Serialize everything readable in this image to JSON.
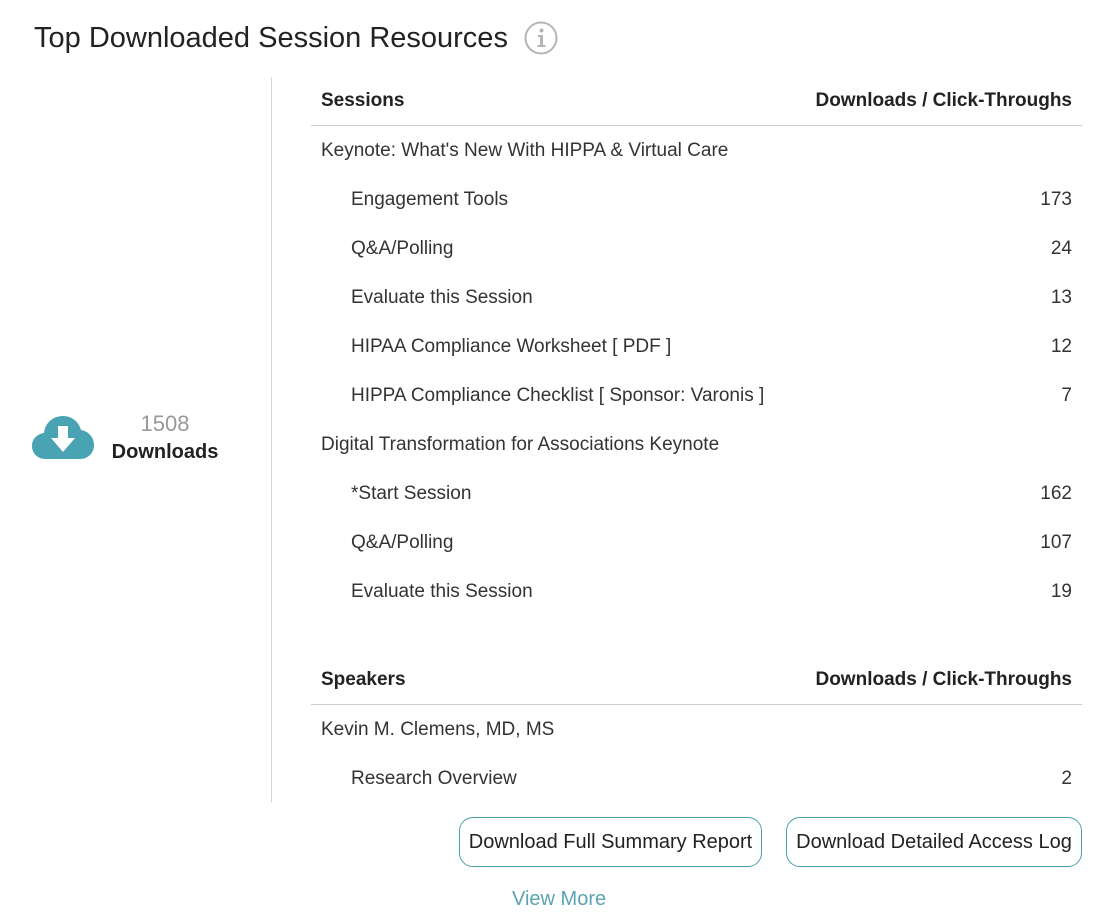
{
  "page": {
    "title": "Top Downloaded Session Resources",
    "info_icon": "info-circle-icon"
  },
  "summary": {
    "icon": "cloud-download-icon",
    "count": "1508",
    "label": "Downloads"
  },
  "colors": {
    "accent": "#4aa3b2",
    "muted_text": "#999999",
    "divider": "#d5d5d5",
    "button_border": "#4a9fae",
    "link": "#5aa3b2"
  },
  "sessions_table": {
    "header_left": "Sessions",
    "header_right": "Downloads / Click-Throughs",
    "groups": [
      {
        "name": "Keynote: What's New With HIPPA & Virtual Care",
        "items": [
          {
            "label": "Engagement Tools",
            "count": "173"
          },
          {
            "label": "Q&A/Polling",
            "count": "24"
          },
          {
            "label": "Evaluate this Session",
            "count": "13"
          },
          {
            "label": "HIPAA Compliance Worksheet [ PDF ]",
            "count": "12"
          },
          {
            "label": "HIPPA Compliance Checklist [ Sponsor: Varonis ]",
            "count": "7"
          }
        ]
      },
      {
        "name": "Digital Transformation for Associations Keynote",
        "items": [
          {
            "label": "*Start Session",
            "count": "162"
          },
          {
            "label": "Q&A/Polling",
            "count": "107"
          },
          {
            "label": "Evaluate this Session",
            "count": "19"
          }
        ]
      }
    ]
  },
  "speakers_table": {
    "header_left": "Speakers",
    "header_right": "Downloads / Click-Throughs",
    "groups": [
      {
        "name": "Kevin M. Clemens, MD, MS",
        "items": [
          {
            "label": "Research Overview",
            "count": "2"
          }
        ]
      }
    ]
  },
  "actions": {
    "summary_report_label": "Download Full Summary Report",
    "access_log_label": "Download Detailed Access Log",
    "view_more_label": "View More"
  }
}
